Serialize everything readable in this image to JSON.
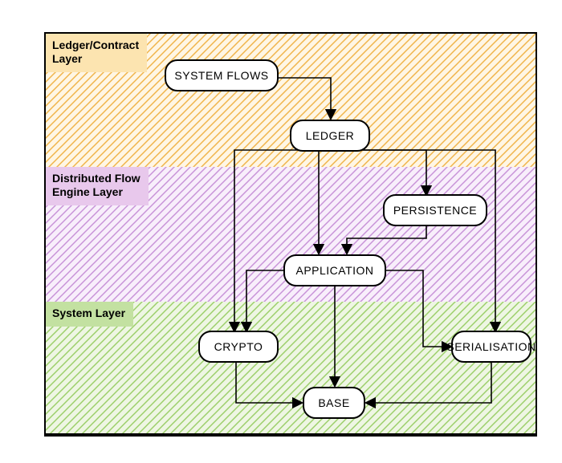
{
  "chart_data": {
    "type": "diagram",
    "title": "",
    "layers": [
      {
        "id": "ledger_contract",
        "label": "Ledger/Contract\nLayer",
        "color": "#f6a623"
      },
      {
        "id": "distributed_flow",
        "label": "Distributed Flow\nEngine Layer",
        "color": "#b96ad9"
      },
      {
        "id": "system",
        "label": "System Layer",
        "color": "#7ab648"
      }
    ],
    "nodes": [
      {
        "id": "system_flows",
        "label": "SYSTEM FLOWS",
        "layer": "ledger_contract"
      },
      {
        "id": "ledger",
        "label": "LEDGER",
        "layer": "ledger_contract"
      },
      {
        "id": "persistence",
        "label": "PERSISTENCE",
        "layer": "distributed_flow"
      },
      {
        "id": "application",
        "label": "APPLICATION",
        "layer": "distributed_flow"
      },
      {
        "id": "crypto",
        "label": "CRYPTO",
        "layer": "system"
      },
      {
        "id": "serialisation",
        "label": "SERIALISATION",
        "layer": "system"
      },
      {
        "id": "base",
        "label": "BASE",
        "layer": "system"
      }
    ],
    "edges": [
      {
        "from": "system_flows",
        "to": "ledger"
      },
      {
        "from": "ledger",
        "to": "crypto"
      },
      {
        "from": "ledger",
        "to": "application"
      },
      {
        "from": "ledger",
        "to": "persistence"
      },
      {
        "from": "ledger",
        "to": "serialisation"
      },
      {
        "from": "persistence",
        "to": "application"
      },
      {
        "from": "application",
        "to": "crypto"
      },
      {
        "from": "application",
        "to": "base"
      },
      {
        "from": "application",
        "to": "serialisation"
      },
      {
        "from": "crypto",
        "to": "base"
      },
      {
        "from": "serialisation",
        "to": "base"
      }
    ]
  },
  "layers": {
    "l1_label": "Ledger/Contract\nLayer",
    "l2_label": "Distributed Flow\nEngine Layer",
    "l3_label": "System Layer"
  },
  "nodes": {
    "system_flows": "SYSTEM FLOWS",
    "ledger": "LEDGER",
    "persistence": "PERSISTENCE",
    "application": "APPLICATION",
    "crypto": "CRYPTO",
    "serialisation": "SERIALISATION",
    "base": "BASE"
  }
}
